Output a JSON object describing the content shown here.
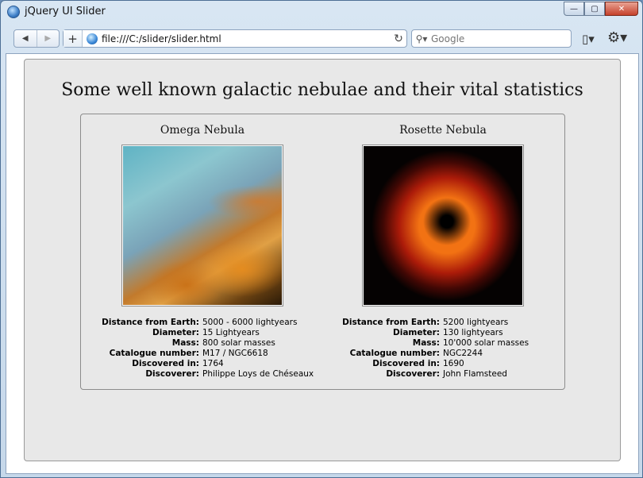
{
  "window": {
    "title": "jQuery UI Slider",
    "controls": {
      "minimize": "—",
      "maximize": "▢",
      "close": "✕"
    }
  },
  "toolbar": {
    "back": "◀",
    "forward": "▶",
    "add": "+",
    "url": "file:///C:/slider/slider.html",
    "reload": "↻",
    "search_placeholder": "Google",
    "page_menu": "▯▾",
    "settings_menu": "⚙▾"
  },
  "page": {
    "title": "Some well known galactic nebulae and their vital statistics"
  },
  "nebulae": [
    {
      "name": "Omega Nebula",
      "stats": [
        {
          "label": "Distance from Earth:",
          "value": "5000 - 6000 lightyears"
        },
        {
          "label": "Diameter:",
          "value": "15 Lightyears"
        },
        {
          "label": "Mass:",
          "value": "800 solar masses"
        },
        {
          "label": "Catalogue number:",
          "value": "M17 / NGC6618"
        },
        {
          "label": "Discovered in:",
          "value": "1764"
        },
        {
          "label": "Discoverer:",
          "value": "Philippe Loys de Chéseaux"
        }
      ]
    },
    {
      "name": "Rosette Nebula",
      "stats": [
        {
          "label": "Distance from Earth:",
          "value": "5200 lightyears"
        },
        {
          "label": "Diameter:",
          "value": "130 lightyears"
        },
        {
          "label": "Mass:",
          "value": "10'000 solar masses"
        },
        {
          "label": "Catalogue number:",
          "value": "NGC2244"
        },
        {
          "label": "Discovered in:",
          "value": "1690"
        },
        {
          "label": "Discoverer:",
          "value": "John Flamsteed"
        }
      ]
    }
  ]
}
